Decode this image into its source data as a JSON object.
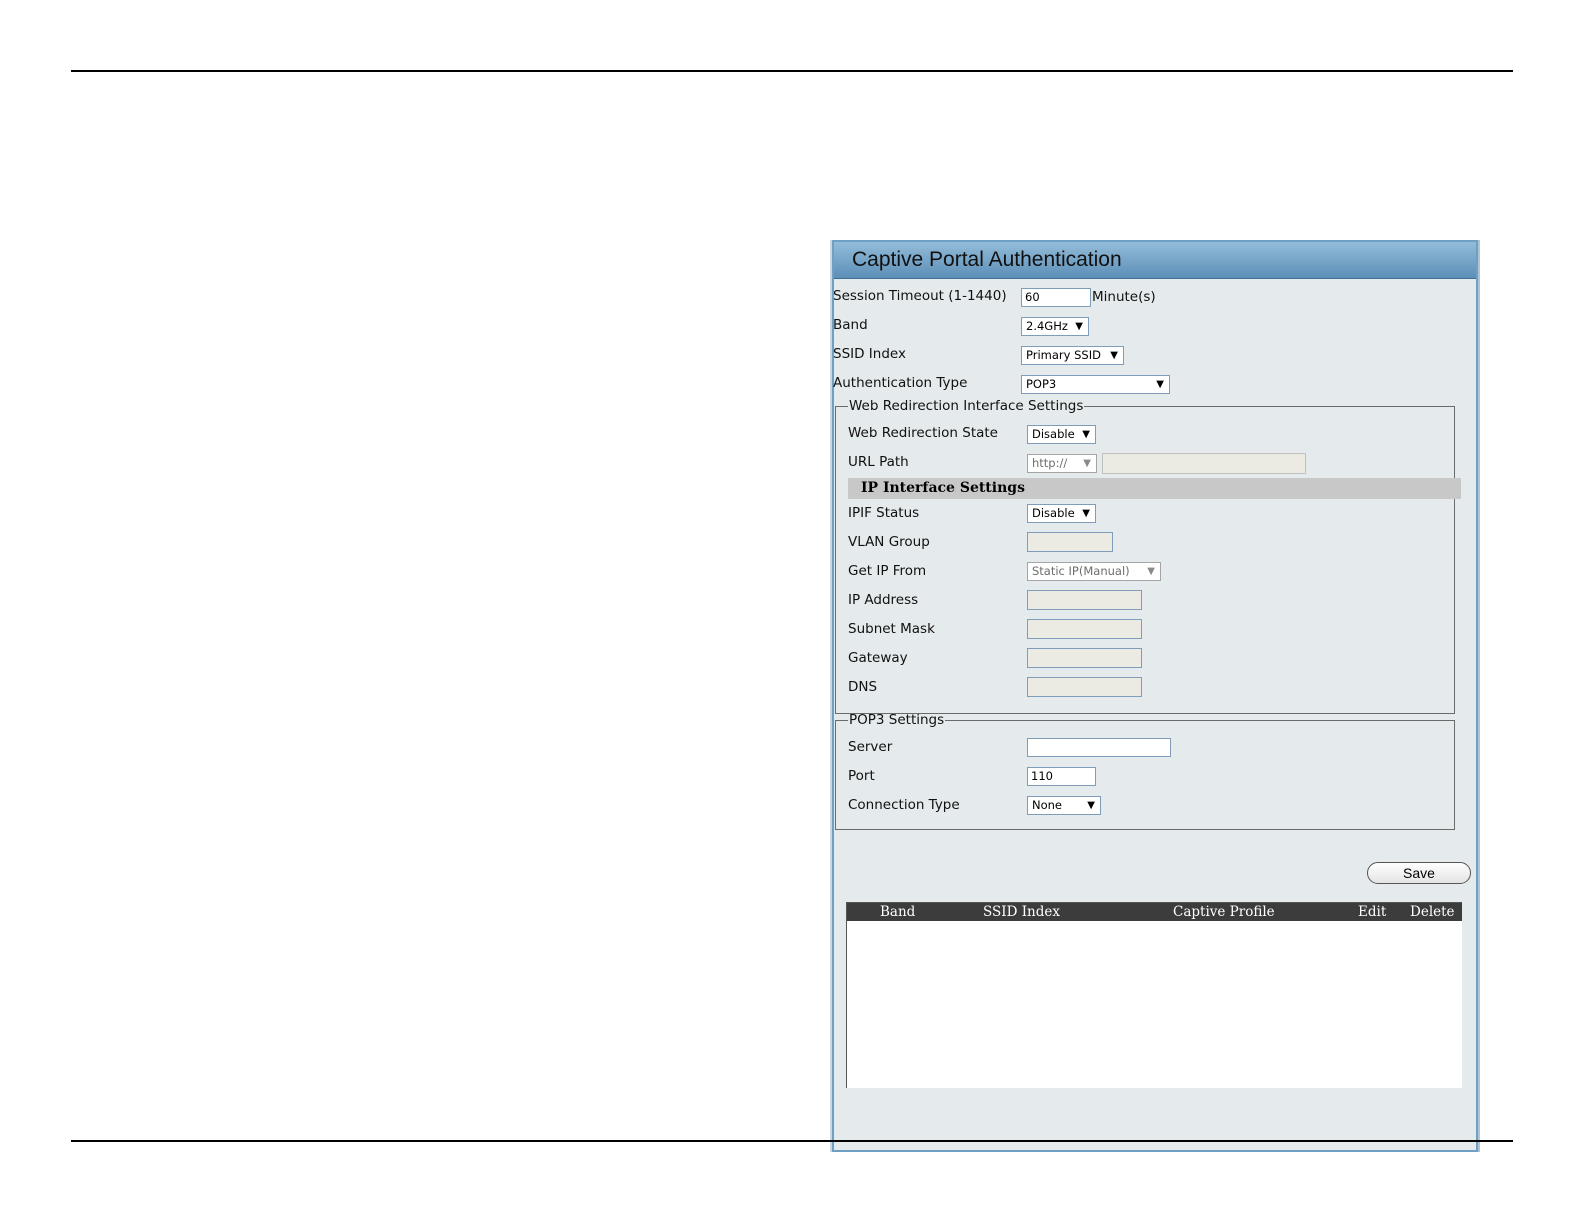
{
  "panel": {
    "title": "Captive Portal Authentication"
  },
  "fields": {
    "session_timeout": {
      "label": "Session Timeout (1-1440)",
      "value": "60",
      "unit": "Minute(s)"
    },
    "band": {
      "label": "Band",
      "value": "2.4GHz"
    },
    "ssid_index": {
      "label": "SSID Index",
      "value": "Primary SSID"
    },
    "auth_type": {
      "label": "Authentication Type",
      "value": "POP3"
    }
  },
  "web_redirection": {
    "legend": "Web Redirection Interface Settings",
    "state": {
      "label": "Web Redirection State",
      "value": "Disable"
    },
    "url_path": {
      "label": "URL Path",
      "scheme": "http://",
      "value": ""
    }
  },
  "ip_interface": {
    "heading": "IP Interface Settings",
    "ipif_status": {
      "label": "IPIF Status",
      "value": "Disable"
    },
    "vlan_group": {
      "label": "VLAN Group",
      "value": ""
    },
    "get_ip_from": {
      "label": "Get IP From",
      "value": "Static IP(Manual)"
    },
    "ip_address": {
      "label": "IP Address",
      "value": ""
    },
    "subnet_mask": {
      "label": "Subnet Mask",
      "value": ""
    },
    "gateway": {
      "label": "Gateway",
      "value": ""
    },
    "dns": {
      "label": "DNS",
      "value": ""
    }
  },
  "pop3": {
    "legend": "POP3 Settings",
    "server": {
      "label": "Server",
      "value": ""
    },
    "port": {
      "label": "Port",
      "value": "110"
    },
    "connection_type": {
      "label": "Connection Type",
      "value": "None"
    }
  },
  "actions": {
    "save_label": "Save"
  },
  "table": {
    "columns": [
      "Band",
      "SSID Index",
      "Captive Profile",
      "Edit",
      "Delete"
    ],
    "rows": []
  },
  "icons": {
    "dropdown": "dropdown-arrow-icon"
  },
  "colors": {
    "panel_bg": "#e5ebec",
    "title_bar": "#5d8fb8",
    "table_header": "#3c3c3c"
  }
}
